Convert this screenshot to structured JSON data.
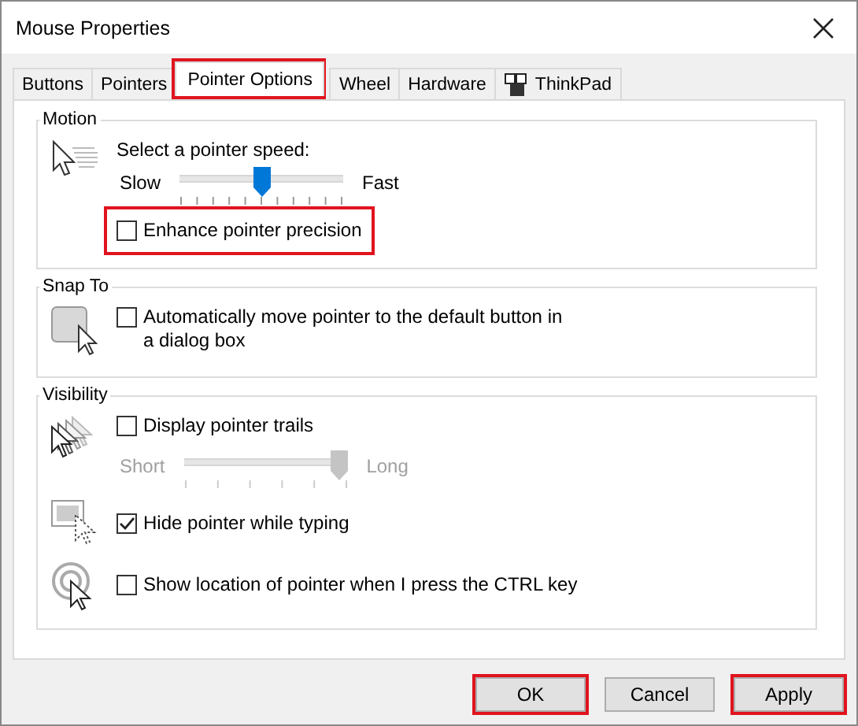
{
  "window": {
    "title": "Mouse Properties"
  },
  "tabs": [
    {
      "label": "Buttons",
      "selected": false,
      "highlighted": false
    },
    {
      "label": "Pointers",
      "selected": false,
      "highlighted": false
    },
    {
      "label": "Pointer Options",
      "selected": true,
      "highlighted": true
    },
    {
      "label": "Wheel",
      "selected": false,
      "highlighted": false
    },
    {
      "label": "Hardware",
      "selected": false,
      "highlighted": false
    },
    {
      "label": "ThinkPad",
      "selected": false,
      "highlighted": false
    }
  ],
  "groups": [
    {
      "title": "Motion",
      "blocks": [
        [
          {
            "kind": "text",
            "label": "Select a pointer speed:"
          },
          {
            "kind": "slider",
            "min_label": "Slow",
            "max_label": "Fast",
            "level": 0.5,
            "disabled": false
          },
          {
            "kind": "checkbox",
            "label": "Enhance pointer precision",
            "checked": false,
            "highlighted": true
          }
        ]
      ]
    },
    {
      "title": "Snap To",
      "blocks": [
        [
          {
            "kind": "checkbox",
            "label": "Automatically move pointer to the default button in a dialog box",
            "checked": false,
            "highlighted": false
          }
        ]
      ]
    },
    {
      "title": "Visibility",
      "blocks": [
        [
          {
            "kind": "checkbox",
            "label": "Display pointer trails",
            "checked": false,
            "highlighted": false
          },
          {
            "kind": "slider",
            "min_label": "Short",
            "max_label": "Long",
            "level": 1,
            "disabled": true
          }
        ],
        [
          {
            "kind": "checkbox",
            "label": "Hide pointer while typing",
            "checked": true,
            "highlighted": false
          }
        ],
        [
          {
            "kind": "checkbox",
            "label": "Show location of pointer when I press the CTRL key",
            "checked": false,
            "highlighted": false
          }
        ]
      ]
    }
  ],
  "buttons": [
    {
      "label": "OK",
      "highlighted": true
    },
    {
      "label": "Cancel",
      "highlighted": false
    },
    {
      "label": "Apply",
      "highlighted": true
    }
  ]
}
